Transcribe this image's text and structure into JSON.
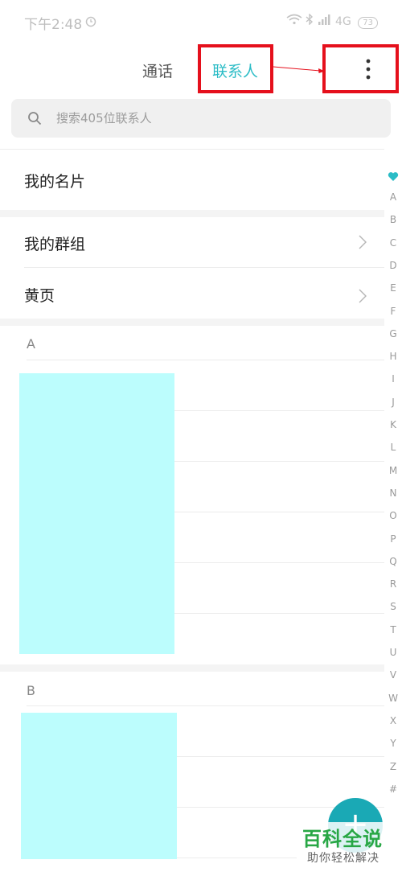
{
  "status_bar": {
    "time": "下午2:48",
    "network": "4G",
    "battery": "73"
  },
  "tabs": [
    {
      "label": "通话",
      "active": false
    },
    {
      "label": "联系人",
      "active": true
    }
  ],
  "search": {
    "placeholder": "搜索405位联系人"
  },
  "rows": {
    "my_card": "我的名片",
    "my_groups": "我的群组",
    "yellow_pages": "黄页"
  },
  "sections": [
    {
      "letter": "A"
    },
    {
      "letter": "B"
    }
  ],
  "index": [
    "A",
    "B",
    "C",
    "D",
    "E",
    "F",
    "G",
    "H",
    "I",
    "J",
    "K",
    "L",
    "M",
    "N",
    "O",
    "P",
    "Q",
    "R",
    "S",
    "T",
    "U",
    "V",
    "W",
    "X",
    "Y",
    "Z",
    "#"
  ],
  "fab": {
    "label": "+"
  },
  "watermark": {
    "title": "百科全说",
    "subtitle": "助你轻松解决"
  },
  "colors": {
    "accent": "#2bbcc6",
    "highlight": "#e5101c",
    "redaction": "#bcfdfd",
    "fab": "#1aa9b5",
    "watermark": "#28a745"
  }
}
